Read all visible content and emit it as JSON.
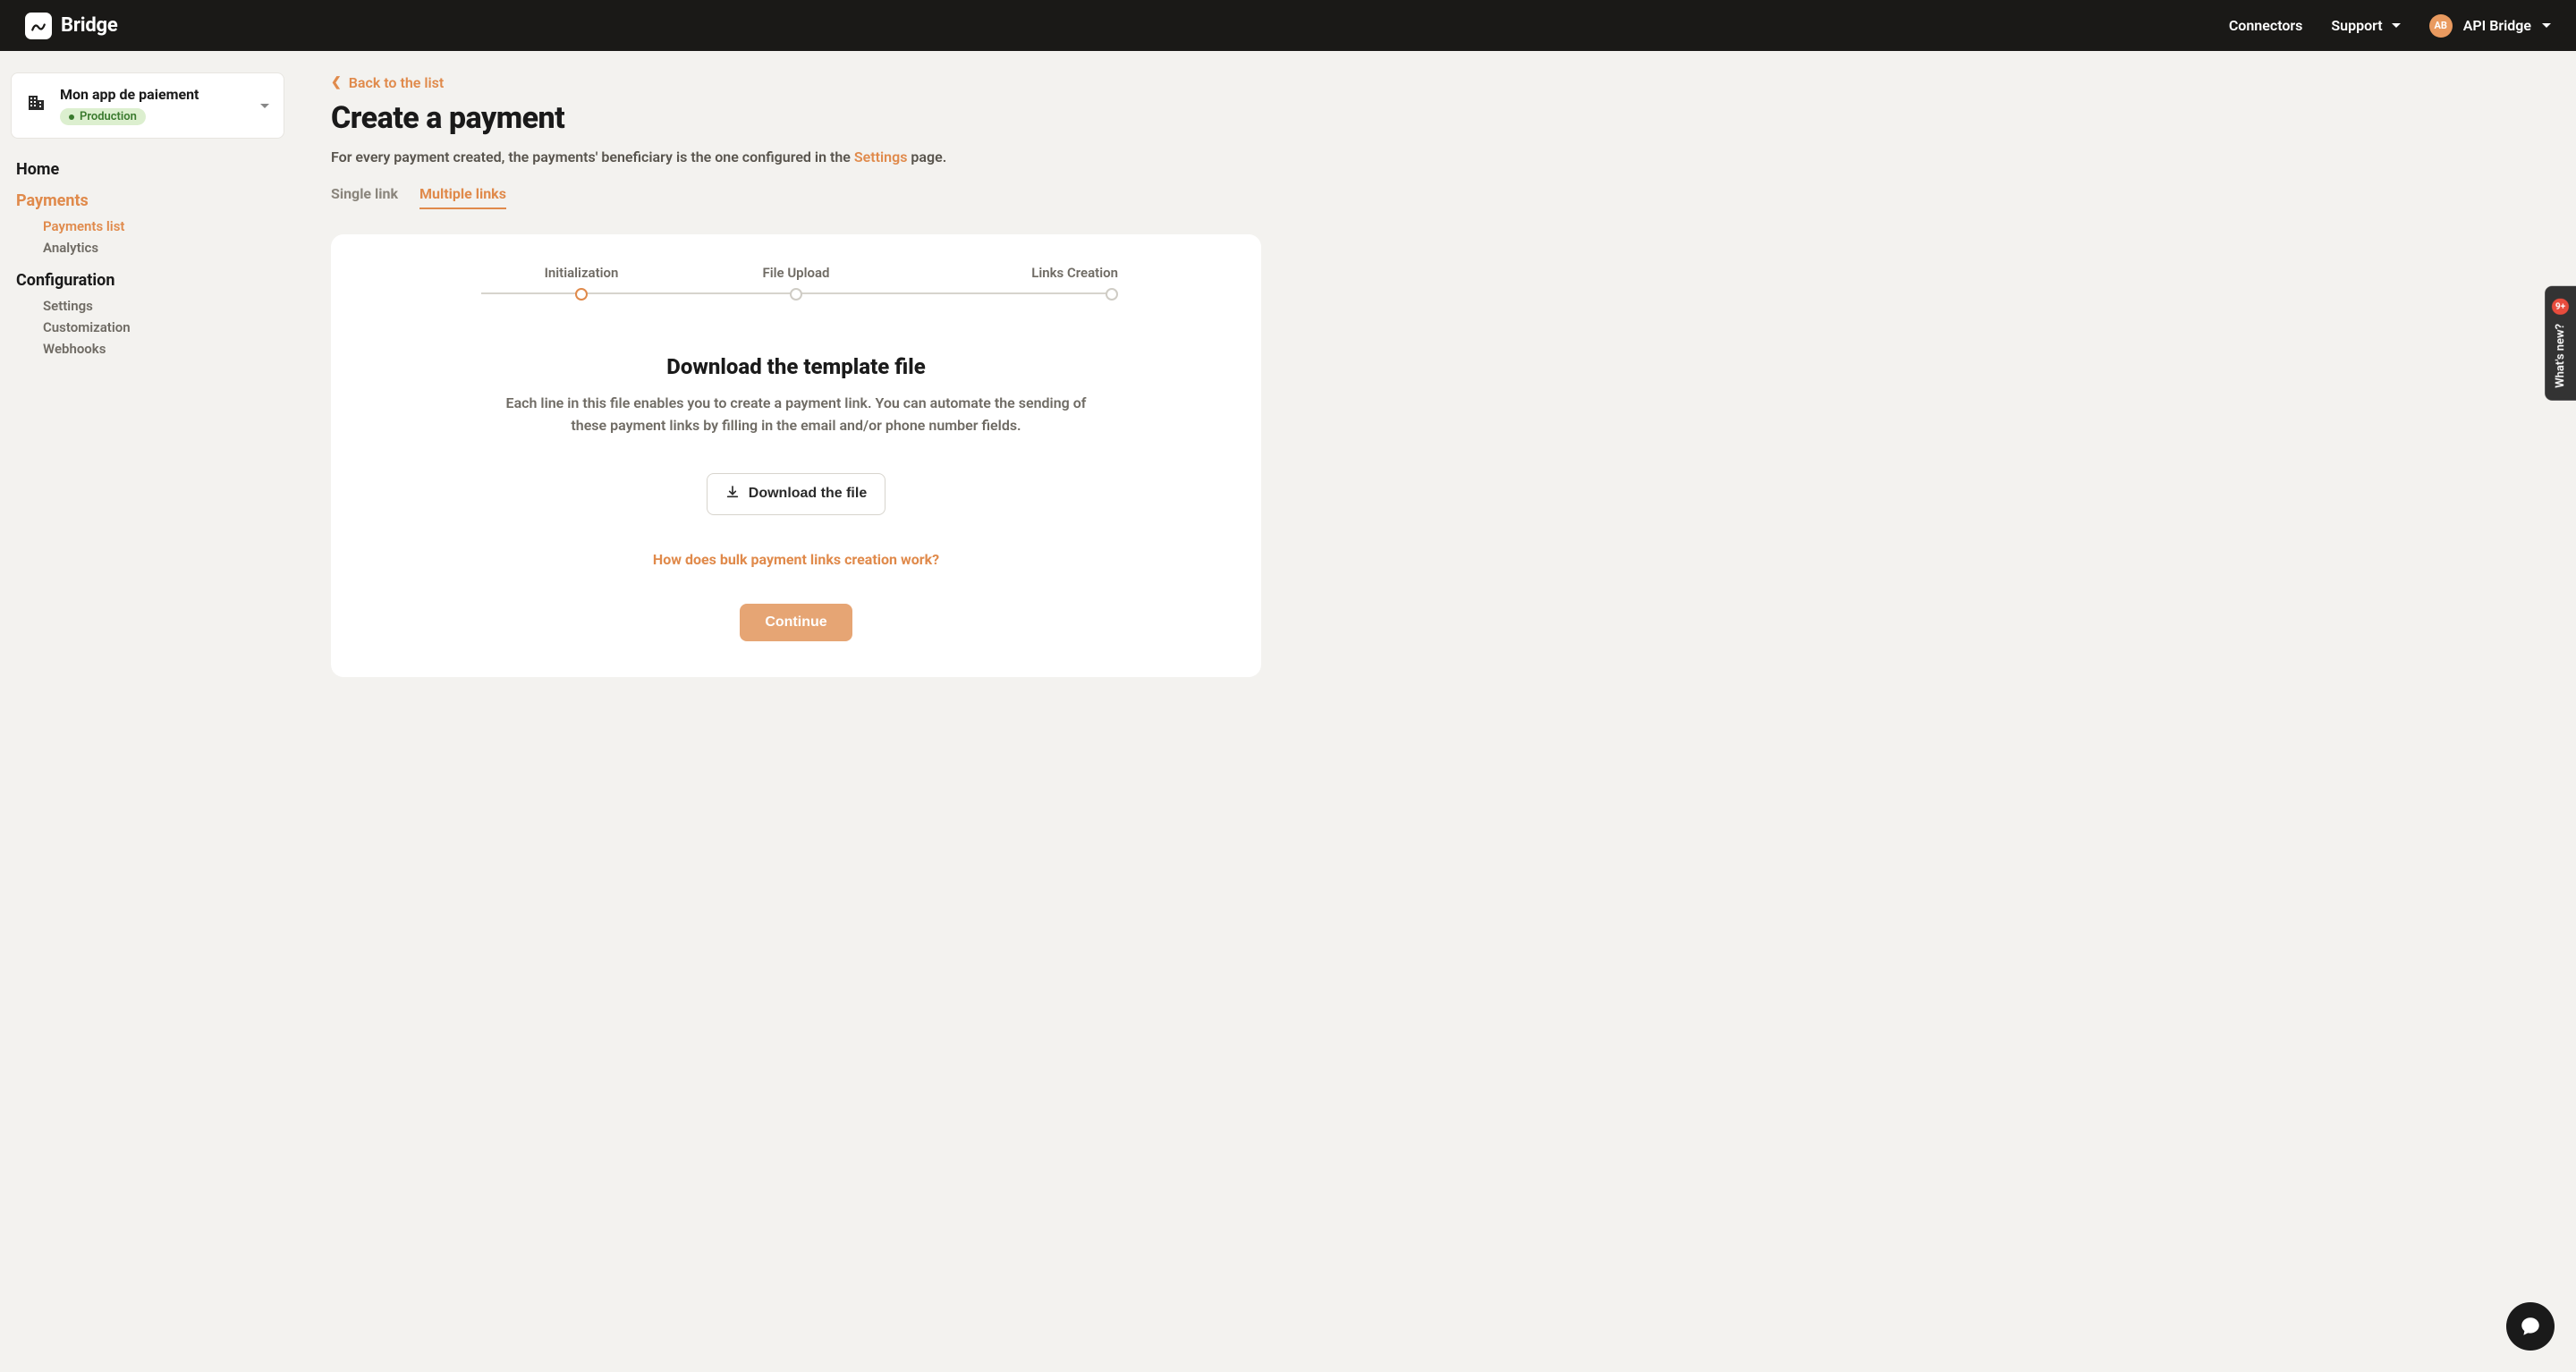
{
  "header": {
    "brand": "Bridge",
    "connectors": "Connectors",
    "support": "Support",
    "user_initials": "AB",
    "user_name": "API Bridge"
  },
  "sidebar": {
    "app_name": "Mon app de paiement",
    "env": "Production",
    "items": {
      "home": "Home",
      "payments": "Payments",
      "payments_list": "Payments list",
      "analytics": "Analytics",
      "configuration": "Configuration",
      "settings": "Settings",
      "customization": "Customization",
      "webhooks": "Webhooks"
    }
  },
  "main": {
    "back": "Back to the list",
    "title": "Create a payment",
    "subtitle_pre": "For every payment created, the payments' beneficiary is the one configured in the ",
    "subtitle_link": "Settings",
    "subtitle_post": " page.",
    "tabs": {
      "single": "Single link",
      "multiple": "Multiple links"
    },
    "steps": {
      "s1": "Initialization",
      "s2": "File Upload",
      "s3": "Links Creation"
    },
    "section_title": "Download the template file",
    "section_desc": "Each line in this file enables you to create a payment link.\nYou can automate the sending of these payment links by filling in the email and/or phone number fields.",
    "download_btn": "Download the file",
    "help_link": "How does bulk payment links creation work?",
    "continue": "Continue"
  },
  "whats_new": {
    "label": "What's new?",
    "badge": "9+"
  }
}
